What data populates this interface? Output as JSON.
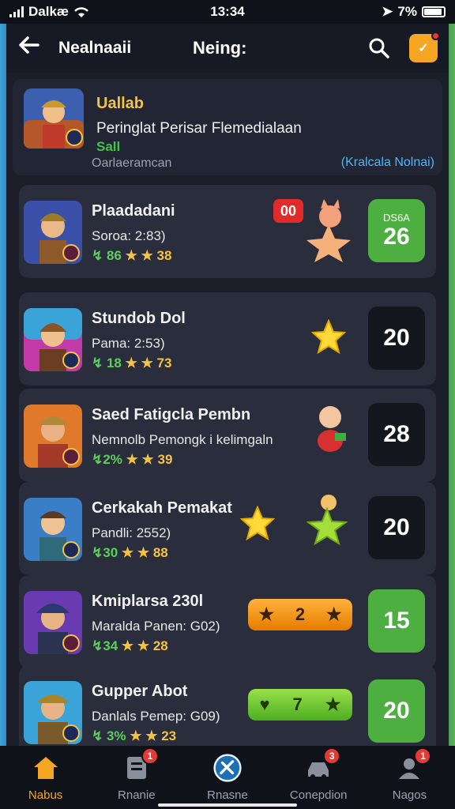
{
  "status_bar": {
    "carrier": "Dalkæ",
    "time": "13:34",
    "battery": "7%"
  },
  "header": {
    "left_title": "Nealnaaii",
    "center_title": "Neing:"
  },
  "featured": {
    "name": "Uallab",
    "description": "Peringlat Perisar Flemedialaan",
    "subtitle": "Sall",
    "meta": "Oarlaeramcan",
    "link": "(Kralcala Nolnai)"
  },
  "rankings": [
    {
      "name": "Plaadadani",
      "detail": "Soroa: 2:83)",
      "stats": [
        "↯ 86",
        "★ ★ 38"
      ],
      "score": "26",
      "score_tag": "DS6A",
      "badge": "00"
    },
    {
      "name": "Stundob Dol",
      "detail": "Pama: 2:53)",
      "stats": [
        "↯ 18",
        "★ ★ 73"
      ],
      "score": "20"
    },
    {
      "name": "Saed Fatigcla Pembn",
      "detail": "Nemnolb Pemongk i kelimgaln",
      "stats": [
        "↯2%",
        "★ ★ 39"
      ],
      "score": "28"
    },
    {
      "name": "Cerkakah Pemakat",
      "detail": "Pandli: 2552)",
      "stats": [
        "↯30",
        "★ ★ 88"
      ],
      "score": "20"
    },
    {
      "name": "Kmiplarsa 230l",
      "detail": "Maralda Panen: G02)",
      "stats": [
        "↯34",
        "★ ★ 28"
      ],
      "score": "15",
      "bonus": "2"
    },
    {
      "name": "Gupper Abot",
      "detail": "Danlals Pemep: G09)",
      "stats": [
        "↯ 3%",
        "★ ★ 23"
      ],
      "score": "20",
      "bonus": "7"
    }
  ],
  "bottom_nav": [
    {
      "label": "Nabus"
    },
    {
      "label": "Rnanie",
      "badge": "1"
    },
    {
      "label": "Rnasne"
    },
    {
      "label": "Conepdion",
      "badge": "3"
    },
    {
      "label": "Nagos",
      "badge": "1"
    }
  ],
  "colors": {
    "accent": "#f5a623",
    "score_green": "#4caf3f",
    "background": "#1b1e28",
    "card": "#2a2d3b",
    "link": "#4ab6ff"
  }
}
